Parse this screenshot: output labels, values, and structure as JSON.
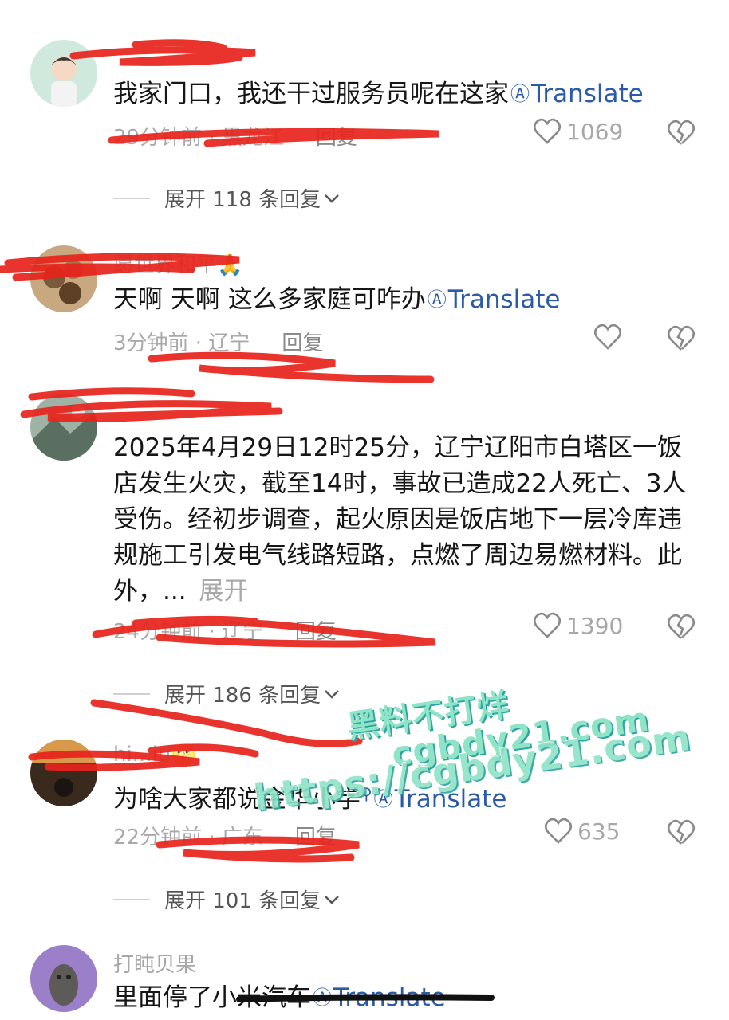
{
  "comments": [
    {
      "username": "",
      "text": "我家门口，我还干过服务员呢在这家",
      "translate": "Translate",
      "meta": "29分钟前 · 黑龙江",
      "reply": "回复",
      "likes": "1069",
      "expand": "展开 118 条回复"
    },
    {
      "username": "愿世界和平🙏",
      "text": "天啊 天啊 这么多家庭可咋办",
      "translate": "Translate",
      "meta": "3分钟前 · 辽宁",
      "reply": "回复",
      "likes": ""
    },
    {
      "username": "",
      "text": "2025年4月29日12时25分，辽宁辽阳市白塔区一饭店发生火灾，截至14时，事故已造成22人死亡、3人受伤。经初步调查，起火原因是饭店地下一层冷库违规施工引发电气线路短路，点燃了周边易燃材料。此外，...",
      "expand_link": "展开",
      "meta": "24分钟前 · 辽宁",
      "reply": "回复",
      "likes": "1390",
      "expand": "展开 186 条回复"
    },
    {
      "username": "hi...iu🌝",
      "text": "为啥大家都说金华小学",
      "translate": "Translate",
      "meta": "22分钟前 · 广东",
      "reply": "回复",
      "likes": "635",
      "expand": "展开 101 条回复"
    },
    {
      "username": "打盹贝果",
      "text": "里面停了小米汽车",
      "translate": "Translate"
    }
  ],
  "watermark": {
    "line1": "黑料不打烊",
    "line2": "cgbdy21.com",
    "line3": "https://cgbdy21.com"
  },
  "colors": {
    "translate": "#2a5aa8",
    "scribble": "#e8231c",
    "watermark": "#8fe3c6"
  }
}
